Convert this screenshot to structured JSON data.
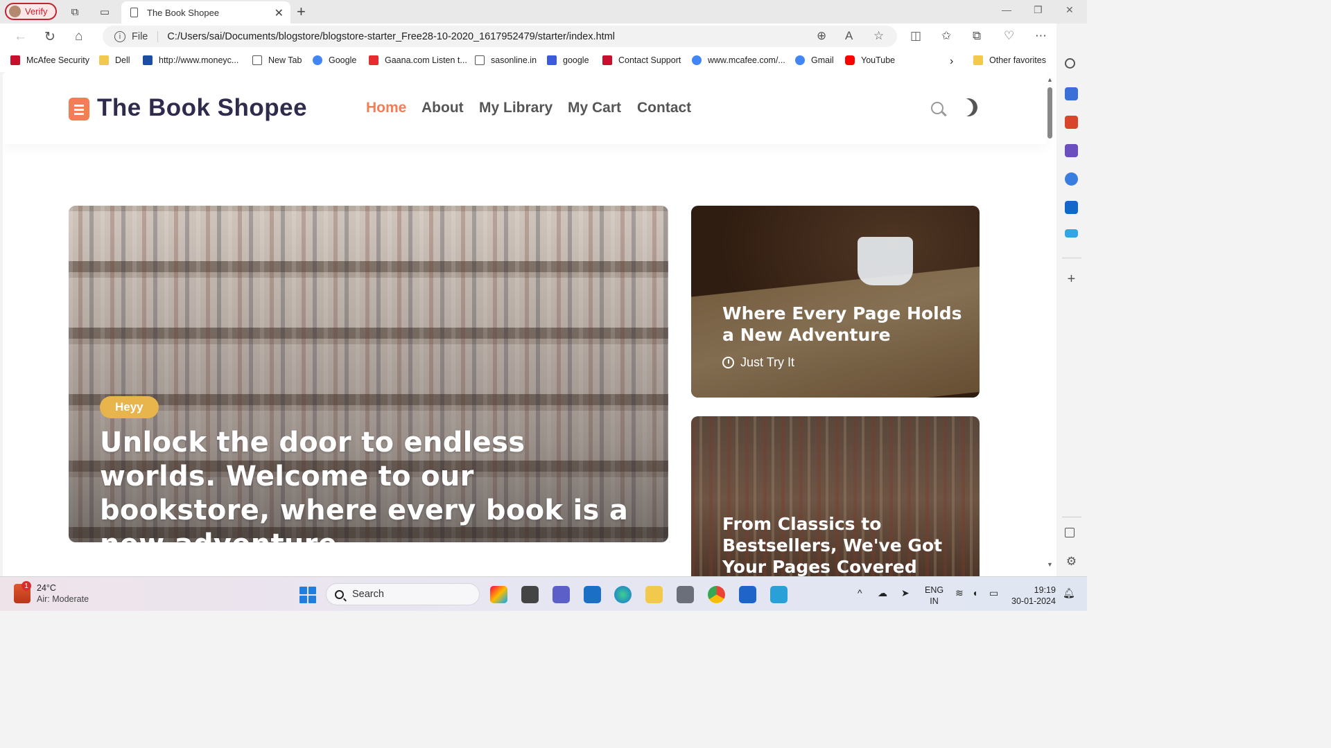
{
  "browser": {
    "verify_label": "Verify",
    "tab_title": "The Book Shopee",
    "url_scheme_label": "File",
    "url": "C:/Users/sai/Documents/blogstore/blogstore-starter_Free28-10-2020_1617952479/starter/index.html",
    "favorites": [
      {
        "label": "McAfee Security",
        "icon": "mcafee-icon",
        "color": "#c8102e"
      },
      {
        "label": "Dell",
        "icon": "folder-icon",
        "color": "#f2c94c"
      },
      {
        "label": "http://www.moneyc...",
        "icon": "moneycontrol-icon",
        "color": "#1b4ea1"
      },
      {
        "label": "New Tab",
        "icon": "page-icon",
        "color": "#555555"
      },
      {
        "label": "Google",
        "icon": "google-icon",
        "color": "#4285f4"
      },
      {
        "label": "Gaana.com Listen t...",
        "icon": "gaana-icon",
        "color": "#e72c30"
      },
      {
        "label": "sasonline.in",
        "icon": "page-icon",
        "color": "#555555"
      },
      {
        "label": "google",
        "icon": "shield-icon",
        "color": "#3b5bdb"
      },
      {
        "label": "Contact Support",
        "icon": "mcafee-icon",
        "color": "#c8102e"
      },
      {
        "label": "www.mcafee.com/...",
        "icon": "google-icon",
        "color": "#4285f4"
      },
      {
        "label": "Gmail",
        "icon": "google-icon",
        "color": "#4285f4"
      },
      {
        "label": "YouTube",
        "icon": "youtube-icon",
        "color": "#ff0000"
      }
    ],
    "other_favorites": "Other favorites"
  },
  "site": {
    "logo_text": "The Book Shopee",
    "nav": [
      {
        "label": "Home",
        "active": true
      },
      {
        "label": "About",
        "active": false
      },
      {
        "label": "My Library",
        "active": false
      },
      {
        "label": "My Cart",
        "active": false
      },
      {
        "label": "Contact",
        "active": false
      }
    ],
    "accent_color": "#f47d58",
    "hero": {
      "tag": "Heyy",
      "title": "Unlock the door to endless worlds. Welcome to our bookstore, where every book is a new adventure"
    },
    "card_2": {
      "title": "Where Every Page Holds a New Adventure",
      "meta": "Just Try It"
    },
    "card_3": {
      "title": "From Classics to Bestsellers, We've Got Your Pages Covered"
    }
  },
  "taskbar": {
    "weather_temp": "24°C",
    "weather_desc": "Air: Moderate",
    "weather_badge": "1",
    "search_placeholder": "Search",
    "lang_top": "ENG",
    "lang_bottom": "IN",
    "time": "19:19",
    "date": "30-01-2024"
  }
}
